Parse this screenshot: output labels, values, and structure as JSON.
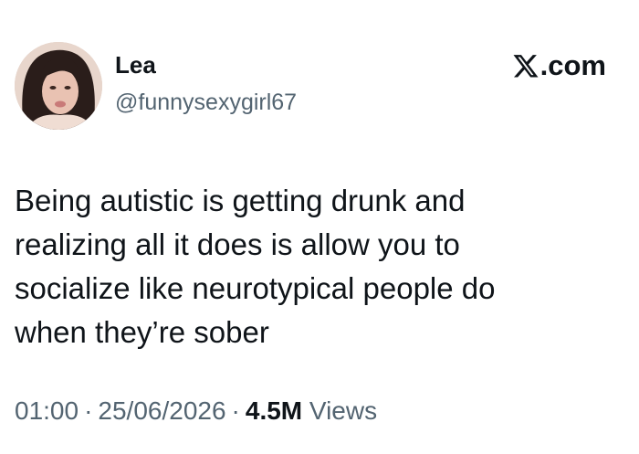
{
  "author": {
    "display_name": "Lea",
    "handle": "@funnysexygirl67"
  },
  "site_mark": {
    "label": ".com",
    "icon": "x-logo-icon"
  },
  "tweet": {
    "lines": [
      "Being autistic is getting drunk and",
      "realizing all it does is allow you to",
      "socialize like neurotypical people do",
      "when they’re sober"
    ]
  },
  "meta": {
    "time": "01:00",
    "date": "25/06/2026",
    "separator": "·",
    "views_count": "4.5M",
    "views_label": "Views"
  },
  "colors": {
    "text_primary": "#0f1419",
    "text_secondary": "#536471",
    "background": "#ffffff"
  }
}
